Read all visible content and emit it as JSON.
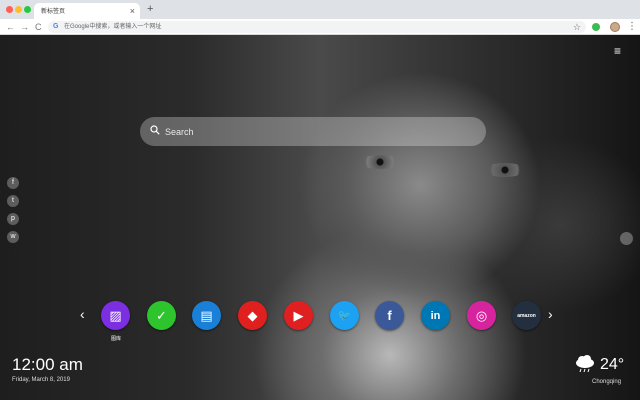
{
  "browser": {
    "tab_title": "新标签页",
    "tab_close": "×",
    "new_tab": "+",
    "nav": {
      "back": "←",
      "forward": "→",
      "reload": "C"
    },
    "omnibox_placeholder": "在Google中搜索，或者输入一个网址",
    "google_letter": "G",
    "bookmark_star": "☆",
    "menu": "⋮"
  },
  "newtab": {
    "menu_icon": "≡",
    "search": {
      "placeholder": "Search"
    },
    "side_icons": [
      "f",
      "t",
      "p",
      "w"
    ],
    "arrows": {
      "left": "‹",
      "right": "›"
    },
    "shortcuts": [
      {
        "name": "gallery",
        "label": "图库",
        "glyph": "▨",
        "color": "#7b2fe0"
      },
      {
        "name": "tasks",
        "label": "",
        "glyph": "✓",
        "color": "#2ec42e"
      },
      {
        "name": "news",
        "label": "",
        "glyph": "▤",
        "color": "#1a7fd6"
      },
      {
        "name": "games",
        "label": "",
        "glyph": "◆",
        "color": "#e01f1f"
      },
      {
        "name": "youtube",
        "label": "",
        "glyph": "▶",
        "color": "#e02020"
      },
      {
        "name": "twitter",
        "label": "",
        "glyph": "🐦",
        "color": "#1da1f2"
      },
      {
        "name": "facebook",
        "label": "",
        "glyph": "f",
        "color": "#3b5998"
      },
      {
        "name": "linkedin",
        "label": "",
        "glyph": "in",
        "color": "#0077b5"
      },
      {
        "name": "instagram",
        "label": "",
        "glyph": "◎",
        "color": "#d6249f"
      },
      {
        "name": "amazon",
        "label": "",
        "glyph": "amazon",
        "color": "#232f3e"
      }
    ],
    "clock": {
      "time": "12:00 am",
      "date": "Friday, March 8, 2019"
    },
    "weather": {
      "temperature": "24°",
      "city": "Chongqing"
    }
  }
}
